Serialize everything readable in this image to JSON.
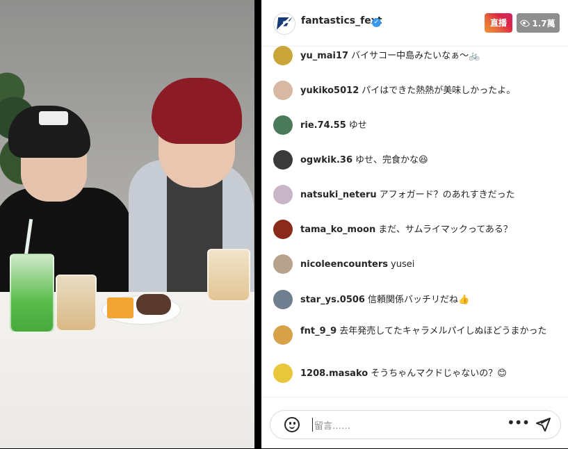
{
  "header": {
    "username": "fantastics_fext",
    "verified_badge": "✓",
    "live_label": "直播",
    "viewer_count": "1.7萬"
  },
  "comments": [
    {
      "user": "yu_mai17",
      "text": "バイサコー中島みたいなぁ～🚲",
      "avatar_color": "#c9a53a"
    },
    {
      "user": "yukiko5012",
      "text": "パイはできた熱熱が美味しかったよ。",
      "avatar_color": "#d7b9a3"
    },
    {
      "user": "rie.74.55",
      "text": "ゆせ",
      "avatar_color": "#4b7a5a"
    },
    {
      "user": "ogwkik.36",
      "text": "ゆせ、完食かな😆",
      "avatar_color": "#3a3a3a"
    },
    {
      "user": "natsuki_neteru",
      "text": "アフォガード？のあれすきだった",
      "avatar_color": "#c8b6c8"
    },
    {
      "user": "tama_ko_moon",
      "text": "まだ、サムライマックってある？",
      "avatar_color": "#8a2a1c"
    },
    {
      "user": "nicoleencounters",
      "text": "yusei",
      "avatar_color": "#b7a28e"
    },
    {
      "user": "star_ys.0506",
      "text": "信頼関係バッチリだね👍",
      "avatar_color": "#6f7f8f"
    },
    {
      "user": "fnt_9_9",
      "text": "去年発売してたキャラメルパイしぬほどうまかった",
      "avatar_color": "#d8a24a"
    },
    {
      "user": "1208.masako",
      "text": "そうちゃんマクドじゃないの？😊",
      "avatar_color": "#e8c83a"
    }
  ],
  "footer": {
    "placeholder": "留言……",
    "more_label": "•••"
  },
  "colors": {
    "live_gradient_start": "#f09433",
    "live_gradient_end": "#cc2366",
    "viewer_badge": "#8e8e8e",
    "verified": "#3897f0"
  },
  "icons": [
    "emoji-icon",
    "more-options-icon",
    "send-icon",
    "eye-icon",
    "verified-icon"
  ]
}
